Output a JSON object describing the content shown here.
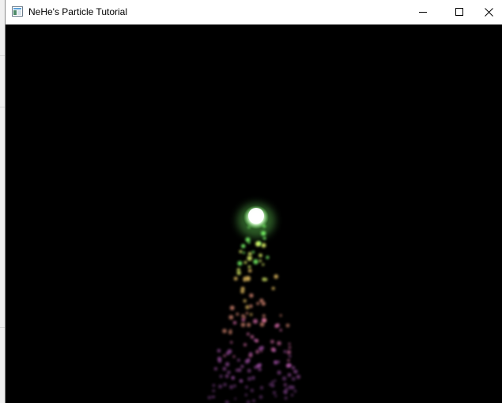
{
  "window": {
    "title": "NeHe's Particle Tutorial",
    "app_icon": "window-app-icon",
    "controls": {
      "minimize_icon": "minimize-icon",
      "maximize_icon": "maximize-icon",
      "close_icon": "close-icon"
    }
  },
  "scene": {
    "background": "#000000",
    "emitter_color": "#f2fff0",
    "particle_colors": [
      "#7cff6a",
      "#e9ff6e",
      "#ffd36c",
      "#ff9f86",
      "#ff7fc7",
      "#d56bdc",
      "#b15cc0"
    ]
  }
}
